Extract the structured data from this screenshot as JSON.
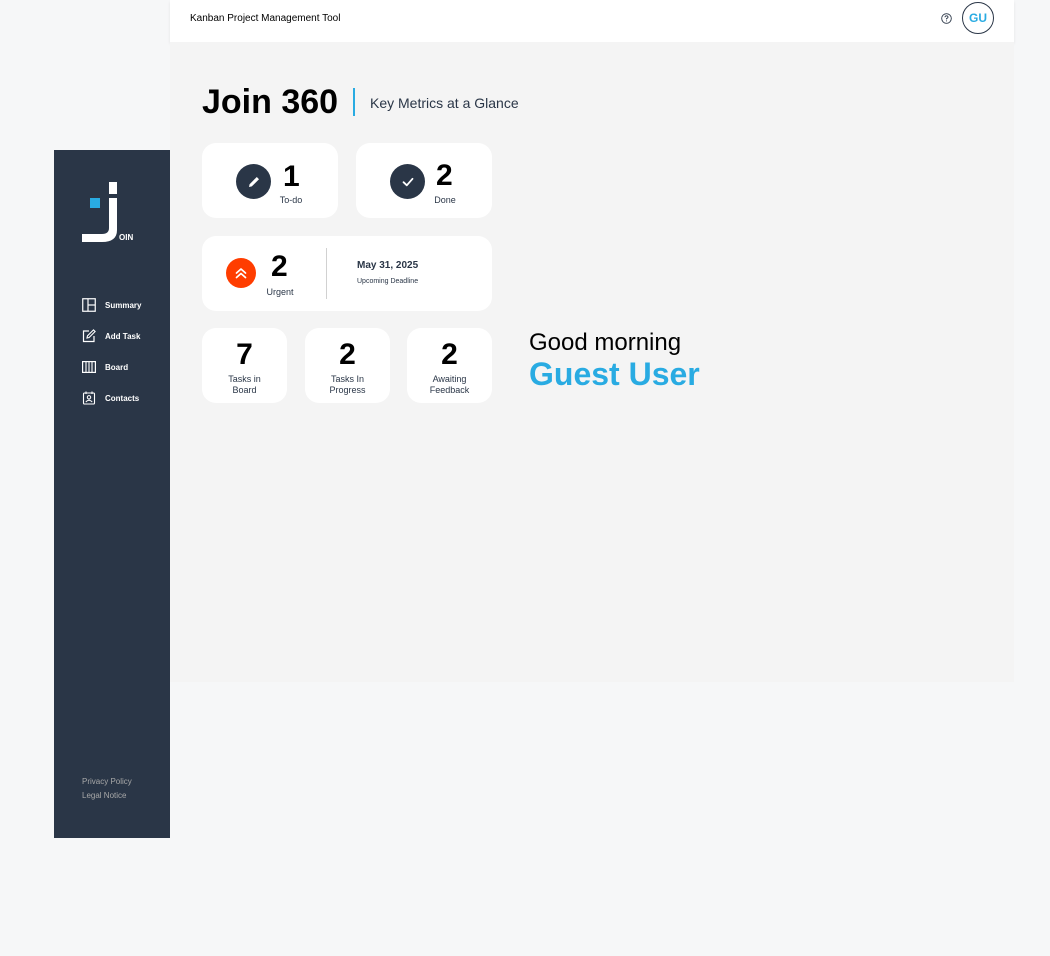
{
  "app": {
    "title": "Kanban Project Management Tool",
    "avatar_initials": "GU",
    "accent_color": "#29abe2",
    "sidebar_color": "#2a3647",
    "urgent_color": "#ff3d00"
  },
  "logo": {
    "suffix": "OIN"
  },
  "sidebar": {
    "items": [
      {
        "label": "Summary",
        "icon": "summary-icon"
      },
      {
        "label": "Add Task",
        "icon": "add-task-icon"
      },
      {
        "label": "Board",
        "icon": "board-icon"
      },
      {
        "label": "Contacts",
        "icon": "contacts-icon"
      }
    ],
    "footer": {
      "privacy": "Privacy Policy",
      "legal": "Legal Notice"
    }
  },
  "header": {
    "title": "Join 360",
    "subtitle": "Key Metrics at a Glance"
  },
  "metrics": {
    "todo": {
      "value": "1",
      "label": "To-do",
      "icon": "pencil-icon"
    },
    "done": {
      "value": "2",
      "label": "Done",
      "icon": "check-icon"
    },
    "urgent": {
      "value": "2",
      "label": "Urgent",
      "icon": "double-chevron-up-icon"
    },
    "deadline": {
      "date": "May 31, 2025",
      "label": "Upcoming Deadline"
    },
    "board": {
      "value": "7",
      "label_line1": "Tasks in",
      "label_line2": "Board"
    },
    "progress": {
      "value": "2",
      "label_line1": "Tasks In",
      "label_line2": "Progress"
    },
    "feedback": {
      "value": "2",
      "label_line1": "Awaiting",
      "label_line2": "Feedback"
    }
  },
  "greeting": {
    "text": "Good morning",
    "name": "Guest User"
  }
}
